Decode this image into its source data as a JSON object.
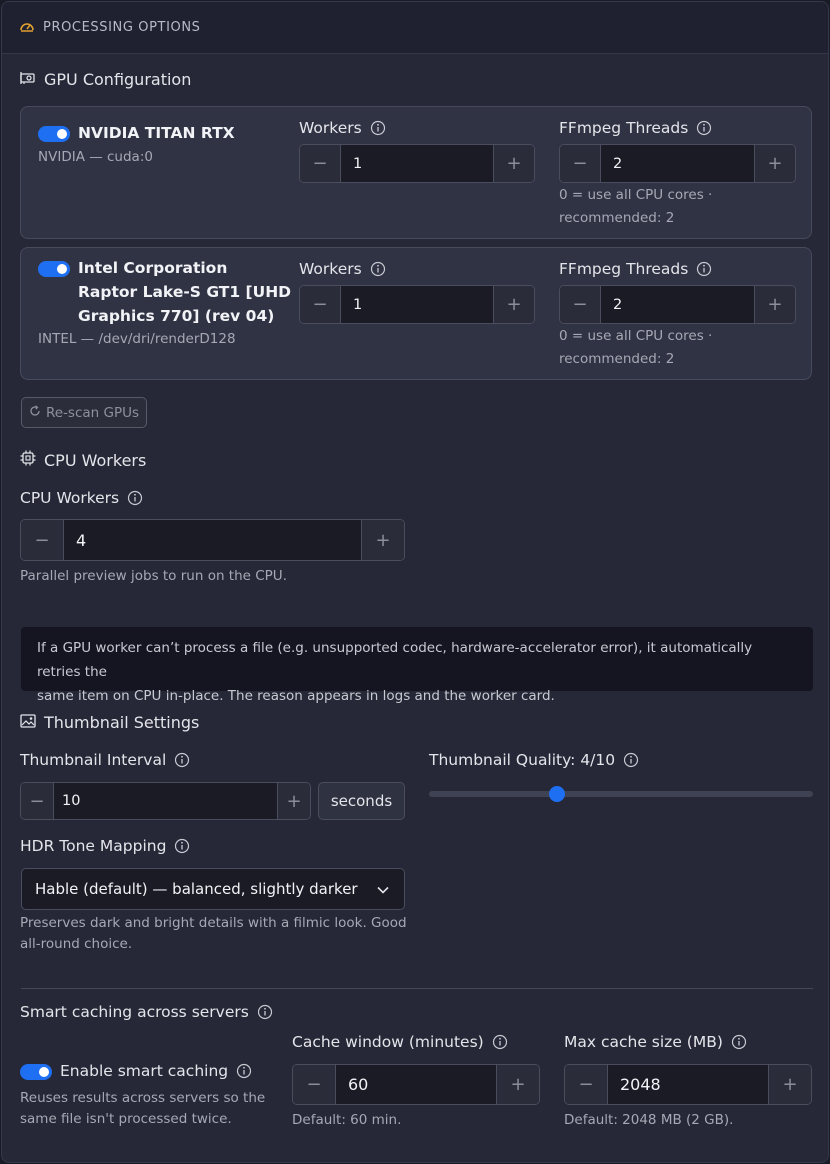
{
  "header": {
    "title": "PROCESSING OPTIONS",
    "icon": "gauge-icon"
  },
  "gpu_section": {
    "title": "GPU Configuration",
    "icon": "gpu-card-icon",
    "cards": [
      {
        "enabled": true,
        "name_lines": [
          "NVIDIA TITAN RTX"
        ],
        "device": "NVIDIA — cuda:0",
        "workers_label": "Workers",
        "workers_value": "1",
        "threads_label": "FFmpeg Threads",
        "threads_value": "2",
        "threads_hint_1": "0 = use all CPU cores ·",
        "threads_hint_2": "recommended: 2"
      },
      {
        "enabled": true,
        "name_lines": [
          "Intel Corporation",
          "Raptor Lake-S GT1 [UHD",
          "Graphics 770] (rev 04)"
        ],
        "device": "INTEL — /dev/dri/renderD128",
        "workers_label": "Workers",
        "workers_value": "1",
        "threads_label": "FFmpeg Threads",
        "threads_value": "2",
        "threads_hint_1": "0 = use all CPU cores ·",
        "threads_hint_2": "recommended: 2"
      }
    ],
    "rescan_label": "Re-scan GPUs"
  },
  "cpu_section": {
    "title": "CPU Workers",
    "icon": "cpu-chip-icon",
    "label": "CPU Workers",
    "value": "4",
    "hint": "Parallel preview jobs to run on the CPU."
  },
  "fallback_note": {
    "line1": "If a GPU worker can’t process a file (e.g. unsupported codec, hardware-accelerator error), it automatically retries the",
    "line2": "same item on CPU in-place. The reason appears in logs and the worker card."
  },
  "thumbnail_section": {
    "title": "Thumbnail Settings",
    "icon": "image-icon",
    "interval_label": "Thumbnail Interval",
    "interval_value": "10",
    "interval_unit": "seconds",
    "quality_label": "Thumbnail Quality: 4/10",
    "quality_value": 4,
    "quality_max": 10,
    "hdr_label": "HDR Tone Mapping",
    "hdr_selected": "Hable (default) — balanced, slightly darker",
    "hdr_hint_1": "Preserves dark and bright details with a filmic look. Good",
    "hdr_hint_2": "all-round choice."
  },
  "cache_section": {
    "title": "Smart caching across servers",
    "enable_label": "Enable smart caching",
    "enabled": true,
    "enable_hint_1": "Reuses results across servers so the",
    "enable_hint_2": "same file isn't processed twice.",
    "window_label": "Cache window (minutes)",
    "window_value": "60",
    "window_hint": "Default: 60 min.",
    "size_label": "Max cache size (MB)",
    "size_value": "2048",
    "size_hint": "Default: 2048 MB (2 GB)."
  },
  "colors": {
    "accent": "#1e6ff2",
    "panel": "#262837",
    "background": "#1a1b26"
  }
}
